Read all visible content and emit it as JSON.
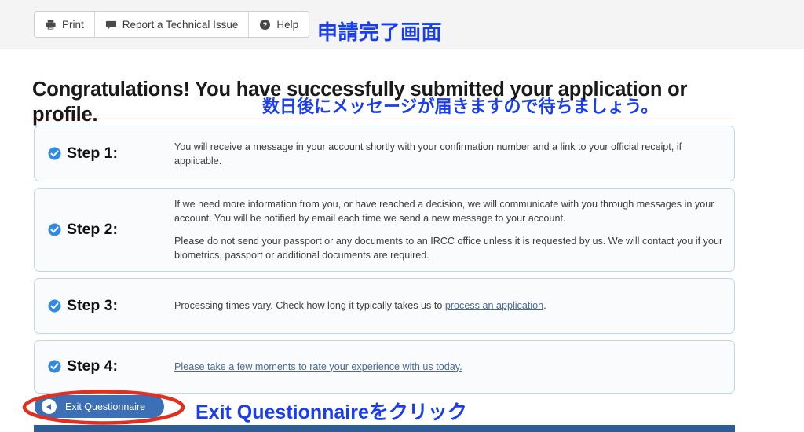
{
  "toolbar": {
    "buttons": [
      {
        "label": "Print",
        "icon": "printer-icon"
      },
      {
        "label": "Report a Technical Issue",
        "icon": "speech-bubble-icon"
      },
      {
        "label": "Help",
        "icon": "question-mark-circle-icon"
      }
    ]
  },
  "annotations": {
    "top": "申請完了画面",
    "heading": "数日後にメッセージが届きますので待ちましょう。",
    "bottom": "Exit Questionnaireをクリック",
    "color": "#1b3df0",
    "ellipse_color": "#e03020"
  },
  "main": {
    "title": "Congratulations! You have successfully submitted your application or profile.",
    "steps": [
      {
        "label": "Step 1:",
        "icon": "check-circle-icon",
        "paragraphs": [
          "You will receive a message in your account shortly with your confirmation number and a link to your official receipt, if applicable."
        ]
      },
      {
        "label": "Step 2:",
        "icon": "check-circle-icon",
        "paragraphs": [
          "If we need more information from you, or have reached a decision, we will communicate with you through messages in your account. You will be notified by email each time we send a new message to your account.",
          "Please do not send your passport or any documents to an IRCC office unless it is requested by us. We will contact you if your biometrics, passport or additional documents are required."
        ]
      },
      {
        "label": "Step 3:",
        "icon": "check-circle-icon",
        "text_before_link": "Processing times vary. Check how long it typically takes us to ",
        "link_text": "process an application",
        "text_after_link": "."
      },
      {
        "label": "Step 4:",
        "icon": "check-circle-icon",
        "link_text": "Please take a few moments to rate your experience with us today."
      }
    ]
  },
  "footer": {
    "exit_button_label": "Exit Questionnaire",
    "exit_button_icon": "back-arrow-icon",
    "bar_color": "#2c5d98"
  }
}
